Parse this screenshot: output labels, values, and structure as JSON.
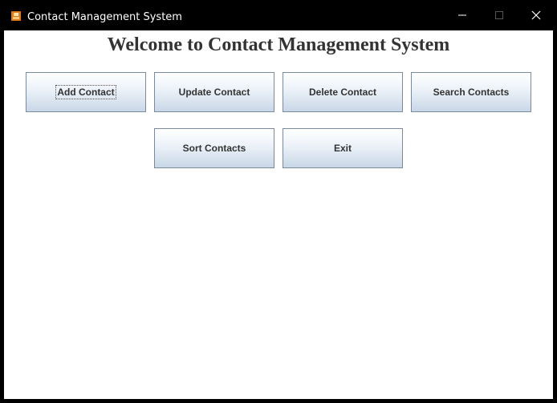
{
  "window": {
    "title": "Contact Management System"
  },
  "heading": "Welcome to Contact Management System",
  "buttons": {
    "add": "Add Contact",
    "update": "Update Contact",
    "delete": "Delete Contact",
    "search": "Search Contacts",
    "sort": "Sort Contacts",
    "exit": "Exit"
  },
  "icons": {
    "app": "java-app-icon",
    "minimize": "minimize-icon",
    "maximize": "maximize-icon",
    "close": "close-icon"
  }
}
